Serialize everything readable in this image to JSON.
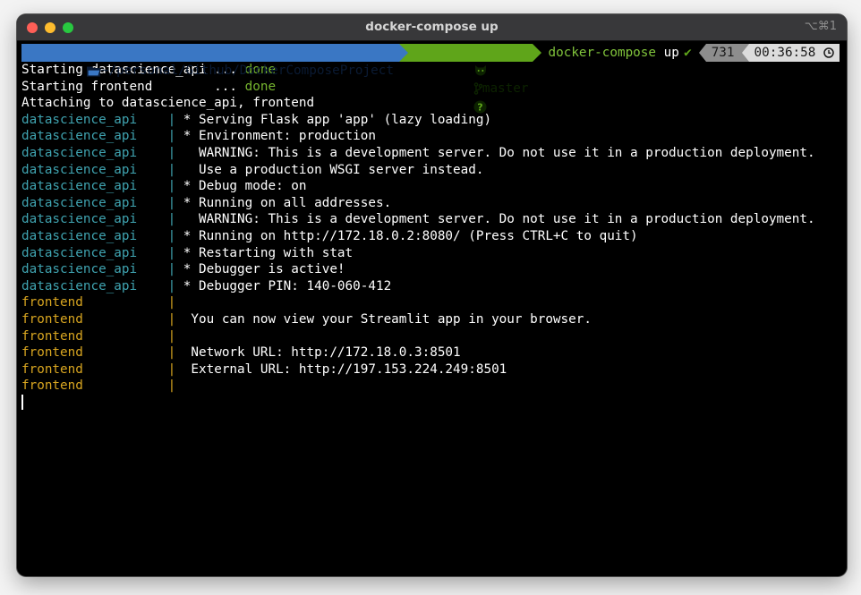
{
  "window": {
    "title": "docker-compose up",
    "shortcut": "⌥⌘1"
  },
  "prompt": {
    "path": "~/personal/Github/DockerComposeProject",
    "branch": "master",
    "branch_status": "?",
    "command": "docker-compose",
    "command_arg": "up",
    "status_check": "✔",
    "history_number": "731",
    "time": "00:36:58"
  },
  "colors": {
    "path_segment": "#3a77c4",
    "git_segment": "#5fa51a",
    "datascience_api": "#3fa3b0",
    "frontend": "#d8a520",
    "done": "#76b52f"
  },
  "output": {
    "start_lines": [
      {
        "prefix": "Starting datascience_api ... ",
        "status": "done"
      },
      {
        "prefix": "Starting frontend        ... ",
        "status": "done"
      }
    ],
    "attach_line": "Attaching to datascience_api, frontend",
    "service_lines": [
      {
        "service": "datascience_api",
        "pipe": "|",
        "text": " * Serving Flask app 'app' (lazy loading)",
        "svc_class": "ds"
      },
      {
        "service": "datascience_api",
        "pipe": "|",
        "text": " * Environment: production",
        "svc_class": "ds"
      },
      {
        "service": "datascience_api",
        "pipe": "|",
        "text": "   WARNING: This is a development server. Do not use it in a production deployment.",
        "svc_class": "ds"
      },
      {
        "service": "datascience_api",
        "pipe": "|",
        "text": "   Use a production WSGI server instead.",
        "svc_class": "ds"
      },
      {
        "service": "datascience_api",
        "pipe": "|",
        "text": " * Debug mode: on",
        "svc_class": "ds"
      },
      {
        "service": "datascience_api",
        "pipe": "|",
        "text": " * Running on all addresses.",
        "svc_class": "ds"
      },
      {
        "service": "datascience_api",
        "pipe": "|",
        "text": "   WARNING: This is a development server. Do not use it in a production deployment.",
        "svc_class": "ds"
      },
      {
        "service": "datascience_api",
        "pipe": "|",
        "text": " * Running on http://172.18.0.2:8080/ (Press CTRL+C to quit)",
        "svc_class": "ds"
      },
      {
        "service": "datascience_api",
        "pipe": "|",
        "text": " * Restarting with stat",
        "svc_class": "ds"
      },
      {
        "service": "datascience_api",
        "pipe": "|",
        "text": " * Debugger is active!",
        "svc_class": "ds"
      },
      {
        "service": "datascience_api",
        "pipe": "|",
        "text": " * Debugger PIN: 140-060-412",
        "svc_class": "ds"
      },
      {
        "service": "frontend",
        "pipe": "|",
        "text": "",
        "svc_class": "fe"
      },
      {
        "service": "frontend",
        "pipe": "|",
        "text": "  You can now view your Streamlit app in your browser.",
        "svc_class": "fe"
      },
      {
        "service": "frontend",
        "pipe": "|",
        "text": "",
        "svc_class": "fe"
      },
      {
        "service": "frontend",
        "pipe": "|",
        "text": "  Network URL: http://172.18.0.3:8501",
        "svc_class": "fe"
      },
      {
        "service": "frontend",
        "pipe": "|",
        "text": "  External URL: http://197.153.224.249:8501",
        "svc_class": "fe"
      },
      {
        "service": "frontend",
        "pipe": "|",
        "text": "",
        "svc_class": "fe"
      }
    ]
  },
  "icons": {
    "folder": "folder-icon",
    "github": "github-icon",
    "branch": "git-branch-icon",
    "clock": "clock-icon"
  }
}
